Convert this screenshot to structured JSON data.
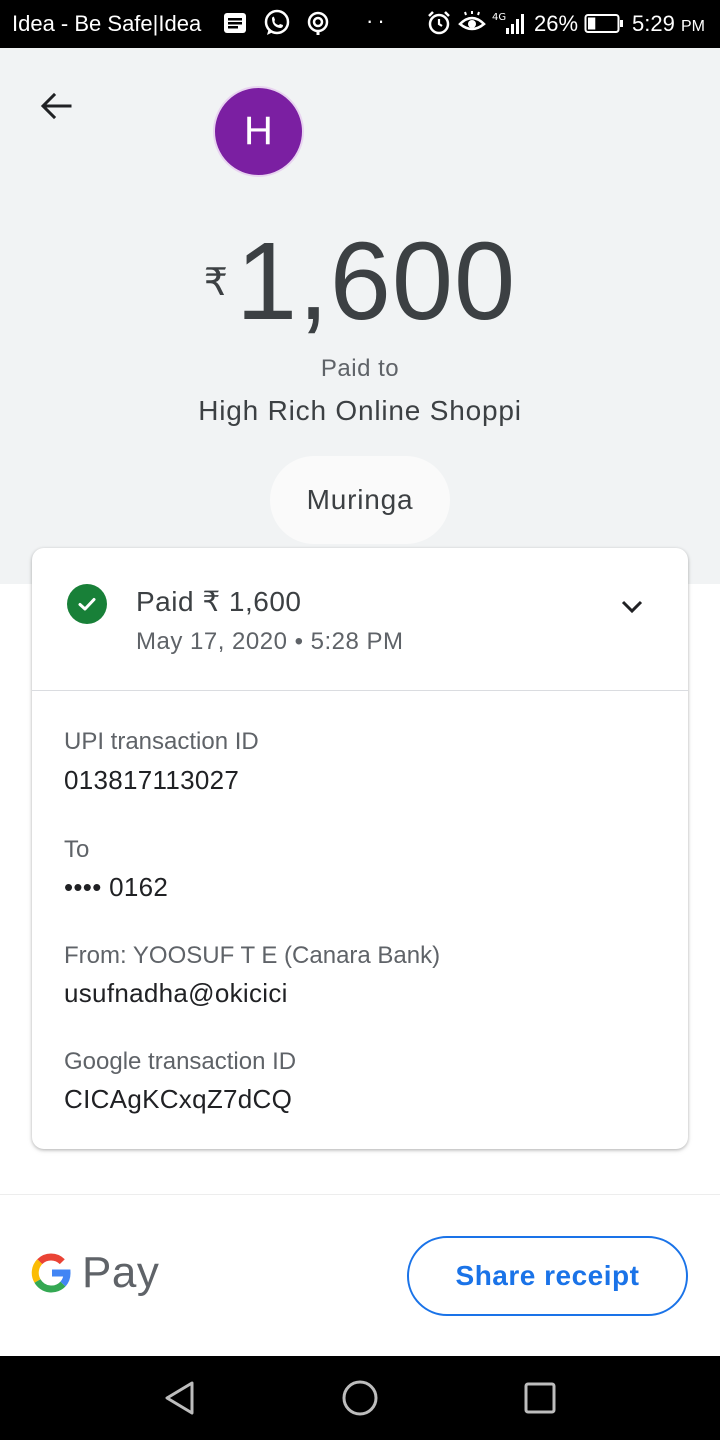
{
  "status_bar": {
    "carrier": "Idea - Be Safe|Idea",
    "dots": "··",
    "network": "4G",
    "battery_percent": "26%",
    "battery_level": 0.26,
    "time": "5:29",
    "ampm": "PM"
  },
  "header": {
    "avatar_letter": "H",
    "avatar_color": "#7b1fa2",
    "currency_symbol": "₹",
    "amount": "1,600",
    "paid_to_label": "Paid to",
    "merchant_name": "High Rich Online Shoppi",
    "note": "Muringa"
  },
  "status": {
    "title": "Paid ₹ 1,600",
    "datetime": "May 17, 2020 • 5:28 PM",
    "status_color": "#188038"
  },
  "details": [
    {
      "label": "UPI transaction ID",
      "value": "013817113027"
    },
    {
      "label": "To",
      "value": "•••• 0162"
    },
    {
      "label": "From: YOOSUF T E (Canara Bank)",
      "value": "usufnadha@okicici"
    },
    {
      "label": "Google transaction ID",
      "value": "CICAgKCxqZ7dCQ"
    }
  ],
  "footer": {
    "brand_text": "Pay",
    "share_button_label": "Share receipt",
    "accent_color": "#1a73e8"
  }
}
